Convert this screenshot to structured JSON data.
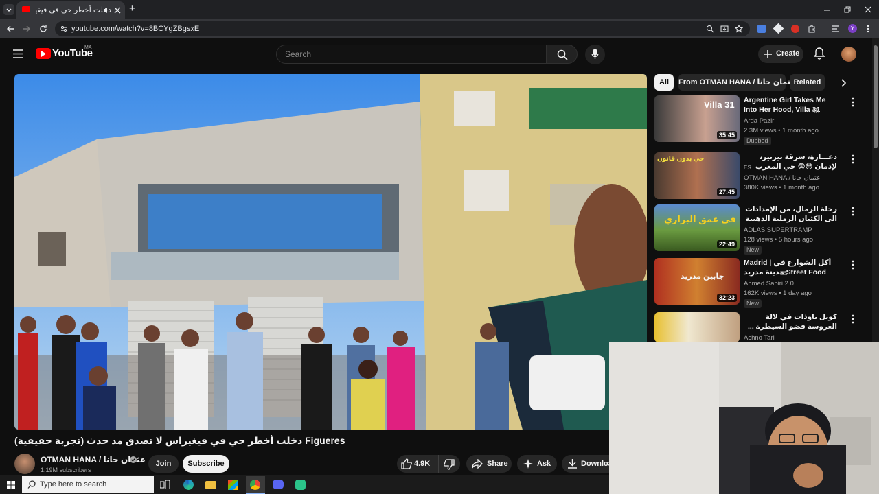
{
  "browser": {
    "tab_title": "دخلت أخطر حي في فيغيراس",
    "new_tab": "+",
    "url": "youtube.com/watch?v=8BCYgZBgsxE"
  },
  "youtube": {
    "logo_text": "YouTube",
    "region": "MA",
    "search_placeholder": "Search",
    "create_label": "Create"
  },
  "chips": [
    "All",
    "From OTMAN HANA / عثمان حانا",
    "Related"
  ],
  "recommendations": [
    {
      "title": "Argentine Girl Takes Me Into Her Hood, Villa 31",
      "lang": "AR",
      "channel": "Arda Pazir",
      "meta": "2.3M views • 1 month ago",
      "badge": "Dubbed",
      "duration": "35:45",
      "thumb_text": "Villa 31",
      "rtl": false
    },
    {
      "title": "دعـــارة، سرقة تيزنيز، لإدمان 😳😨 حي المغرب في اسبانيا",
      "lang": "ES",
      "channel": "OTMAN HANA / عثمان حانا",
      "meta": "380K views • 1 month ago",
      "badge": "",
      "duration": "27:45",
      "thumb_text": "حي بدون قانون",
      "rtl": true
    },
    {
      "title": "رحلة الرمال، من الإمدادات الى الكثبان الرملية الذهبية | بالدراجة الهوائية 🚴",
      "lang": "",
      "channel": "ADLAS SUPERTRAMP",
      "meta": "128 views • 5 hours ago",
      "badge": "New",
      "duration": "22:49",
      "thumb_text": "في عمق البراري",
      "rtl": true
    },
    {
      "title": "Madrid | أكل الشوارع في مدينة مدريد Street Food",
      "lang": "ES",
      "channel": "Ahmed Sabiri 2.0",
      "meta": "162K views • 1 day ago",
      "badge": "New",
      "duration": "32:23",
      "thumb_text": "جابين مدريد",
      "rtl": false
    },
    {
      "title": "كوبل ناوذات في لالة العروسة فضو السيطرة ... ملي عطاوهم مسؤولية الدار وماتحملوش أشنو",
      "lang": "",
      "channel": "Achno Tari",
      "meta": "",
      "badge": "",
      "duration": "",
      "thumb_text": "",
      "rtl": true
    }
  ],
  "video": {
    "title": "دخلت أخطر حي في فيغيراس لا تصدق مد حدث (تجربة حقيقية) Figueres",
    "channel": "OTMAN HANA / عثمان حانا",
    "subscribers": "1.19M subscribers",
    "join": "Join",
    "subscribe": "Subscribe",
    "likes": "4.9K",
    "share": "Share",
    "ask": "Ask",
    "download": "Download"
  },
  "taskbar": {
    "search_placeholder": "Type here to search"
  }
}
